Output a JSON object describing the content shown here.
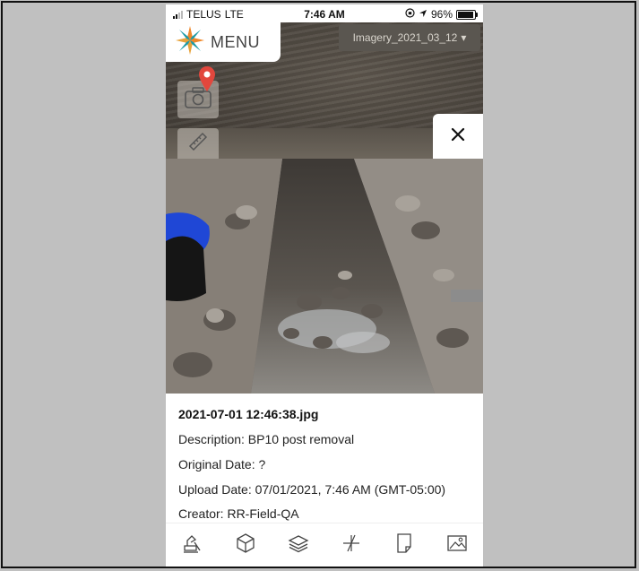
{
  "status_bar": {
    "carrier": "TELUS",
    "network": "LTE",
    "time": "7:46 AM",
    "battery": "96%"
  },
  "header": {
    "menu_label": "MENU",
    "imagery_label": "Imagery_2021_03_12",
    "imagery_caret": "▾"
  },
  "close_glyph": "✕",
  "photo_info": {
    "filename": "2021-07-01 12:46:38.jpg",
    "description": "Description: BP10 post removal",
    "original_date": "Original Date: ?",
    "upload_date": "Upload Date: 07/01/2021, 7:46 AM (GMT-05:00)",
    "creator": "Creator: RR-Field-QA"
  },
  "icons": {
    "logo": "compass-star-logo",
    "camera": "camera-icon",
    "pin": "map-pin-icon",
    "ruler": "ruler-icon",
    "close": "close-icon",
    "toolbar": [
      "excavator-icon",
      "cube-icon",
      "layers-icon",
      "plus-split-icon",
      "document-icon",
      "image-icon"
    ]
  },
  "colors": {
    "logo_orange": "#f0882a",
    "logo_teal": "#1e9aa6",
    "pin_red": "#e2473d",
    "background_gray": "#c0c0c0"
  }
}
